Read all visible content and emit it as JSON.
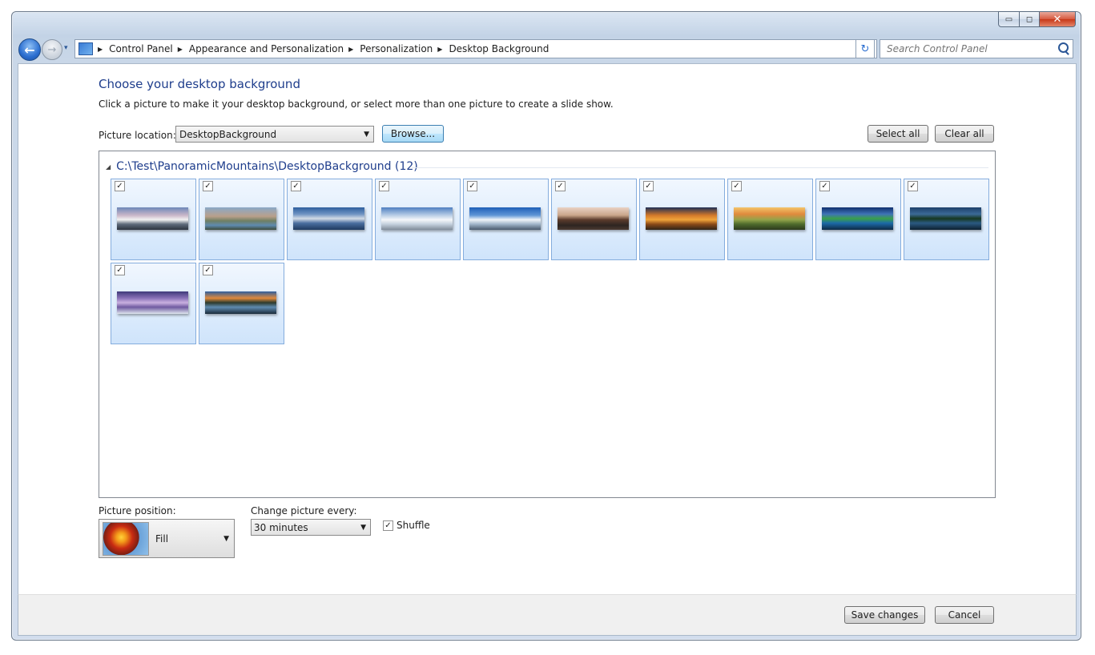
{
  "window": {
    "minimize_glyph": "▭",
    "maximize_glyph": "◻",
    "close_glyph": "✕"
  },
  "nav": {
    "back_glyph": "←",
    "forward_glyph": "→",
    "history_glyph": "▾",
    "breadcrumbs": [
      "Control Panel",
      "Appearance and Personalization",
      "Personalization",
      "Desktop Background"
    ],
    "separator": "▶",
    "address_dropdown": "▼",
    "refresh_glyph": "↻"
  },
  "search": {
    "placeholder": "Search Control Panel"
  },
  "main": {
    "title": "Choose your desktop background",
    "subtitle": "Click a picture to make it your desktop background, or select more than one picture to create a slide show.",
    "picture_location_label": "Picture location:",
    "picture_location_value": "DesktopBackground",
    "browse_label": "Browse...",
    "select_all_label": "Select all",
    "clear_all_label": "Clear all",
    "dropdown_arrow": "▼"
  },
  "gallery": {
    "group_title": "C:\\Test\\PanoramicMountains\\DesktopBackground (12)",
    "collapse_glyph": "◢",
    "check_glyph": "✓",
    "images": [
      {
        "checked": true,
        "icon": "snowy-peak-sunset"
      },
      {
        "checked": true,
        "icon": "alpine-lake"
      },
      {
        "checked": true,
        "icon": "blue-lake-mountains"
      },
      {
        "checked": true,
        "icon": "snow-field"
      },
      {
        "checked": true,
        "icon": "glacier-blue-sky"
      },
      {
        "checked": true,
        "icon": "rock-towers-dusk"
      },
      {
        "checked": true,
        "icon": "golden-cliffs"
      },
      {
        "checked": true,
        "icon": "sunrise-valley"
      },
      {
        "checked": true,
        "icon": "green-lake"
      },
      {
        "checked": true,
        "icon": "dark-lake-reflection"
      },
      {
        "checked": true,
        "icon": "purple-shore"
      },
      {
        "checked": true,
        "icon": "sunset-reflection"
      }
    ]
  },
  "bottom": {
    "picture_position_label": "Picture position:",
    "picture_position_value": "Fill",
    "change_picture_label": "Change picture every:",
    "change_picture_value": "30 minutes",
    "shuffle_label": "Shuffle",
    "shuffle_checked": true
  },
  "footer": {
    "save_label": "Save changes",
    "cancel_label": "Cancel"
  }
}
